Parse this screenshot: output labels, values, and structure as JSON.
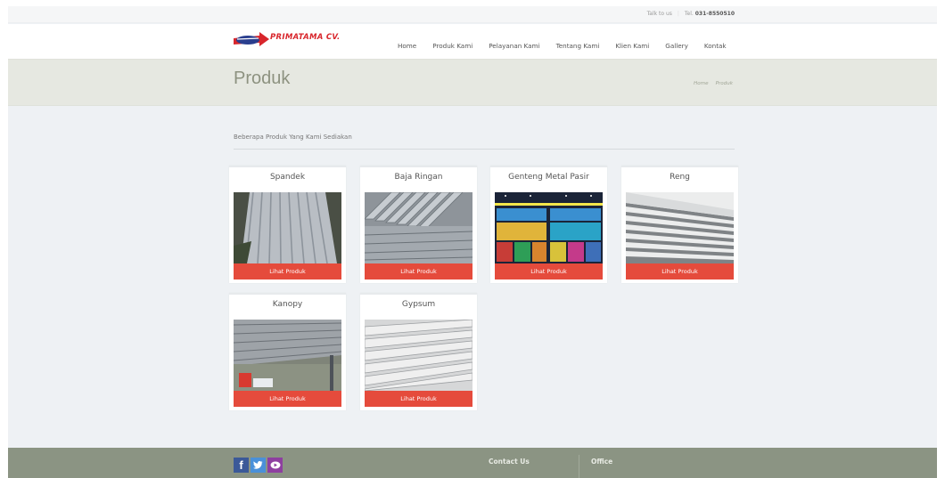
{
  "topbar": {
    "talk_label": "Talk to us",
    "tel_label": "Tel.",
    "tel_number": "031-8550510"
  },
  "header": {
    "logo_text": "PRIMATAMA CV.",
    "nav": [
      {
        "label": "Home"
      },
      {
        "label": "Produk Kami"
      },
      {
        "label": "Pelayanan Kami"
      },
      {
        "label": "Tentang Kami"
      },
      {
        "label": "Klien Kami"
      },
      {
        "label": "Gallery"
      },
      {
        "label": "Kontak"
      }
    ]
  },
  "page": {
    "title": "Produk",
    "breadcrumb": [
      "Home",
      "Produk"
    ]
  },
  "section": {
    "heading": "Beberapa Produk Yang Kami Sediakan"
  },
  "products": [
    {
      "name": "Spandek",
      "button": "Lihat Produk",
      "image_icon": "corrugated-roof-sheet"
    },
    {
      "name": "Baja Ringan",
      "button": "Lihat Produk",
      "image_icon": "steel-c-channel"
    },
    {
      "name": "Genteng Metal Pasir",
      "button": "Lihat Produk",
      "image_icon": "colored-metal-tiles"
    },
    {
      "name": "Reng",
      "button": "Lihat Produk",
      "image_icon": "stacked-flat-sheets"
    },
    {
      "name": "Kanopy",
      "button": "Lihat Produk",
      "image_icon": "canopy-roof"
    },
    {
      "name": "Gypsum",
      "button": "Lihat Produk",
      "image_icon": "gypsum-boards"
    }
  ],
  "footer": {
    "social": [
      "facebook-icon",
      "twitter-icon",
      "youtube-icon"
    ],
    "contact_heading": "Contact Us",
    "office_heading": "Office"
  },
  "colors": {
    "accent": "#e54b3c",
    "footer": "#8b9483",
    "title_band": "#e6e8e1",
    "background": "#eef1f4"
  }
}
